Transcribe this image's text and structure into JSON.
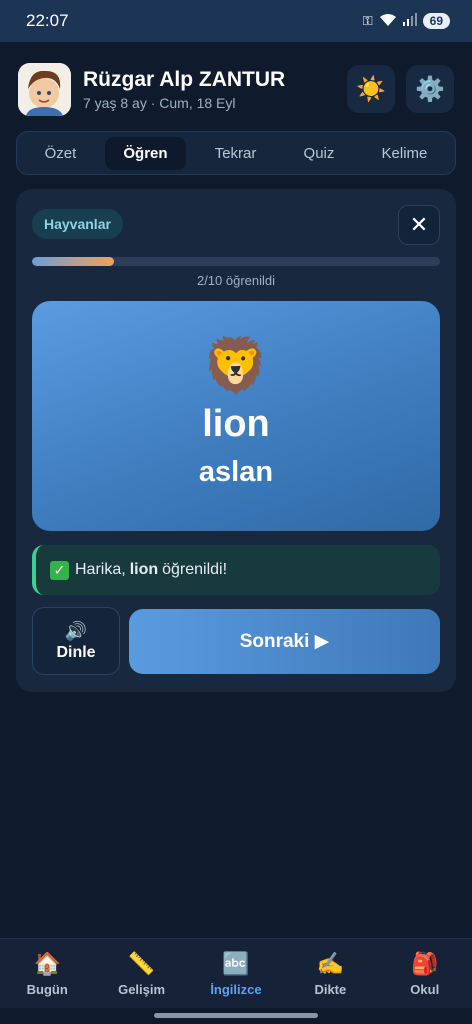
{
  "status_bar": {
    "time": "22:07",
    "battery": "69"
  },
  "user": {
    "name": "Rüzgar Alp ZANTUR",
    "subtitle": "7 yaş 8 ay · Cum, 18 Eyl"
  },
  "header_icons": {
    "theme": "sun-icon",
    "settings": "gear-icon"
  },
  "tabs": [
    {
      "label": "Özet",
      "active": false
    },
    {
      "label": "Öğren",
      "active": true
    },
    {
      "label": "Tekrar",
      "active": false
    },
    {
      "label": "Quiz",
      "active": false
    },
    {
      "label": "Kelime",
      "active": false
    }
  ],
  "lesson": {
    "category": "Hayvanlar",
    "progress_current": 2,
    "progress_total": 10,
    "progress_label": "2/10 öğrenildi",
    "card": {
      "emoji": "🦁",
      "word": "lion",
      "translation": "aslan"
    },
    "feedback": {
      "prefix": "Harika,",
      "word": "lion",
      "suffix": "öğrenildi!"
    },
    "listen_label": "Dinle",
    "next_label": "Sonraki ▶"
  },
  "bottom_nav": [
    {
      "label": "Bugün",
      "icon": "🏠",
      "active": false
    },
    {
      "label": "Gelişim",
      "icon": "📏",
      "active": false
    },
    {
      "label": "İngilizce",
      "icon": "🔤",
      "active": true
    },
    {
      "label": "Dikte",
      "icon": "✍️",
      "active": false
    },
    {
      "label": "Okul",
      "icon": "🎒",
      "active": false
    }
  ],
  "colors": {
    "accent": "#5fa3f0",
    "success": "#3ccf8e",
    "progress_end": "#f0a35a"
  }
}
